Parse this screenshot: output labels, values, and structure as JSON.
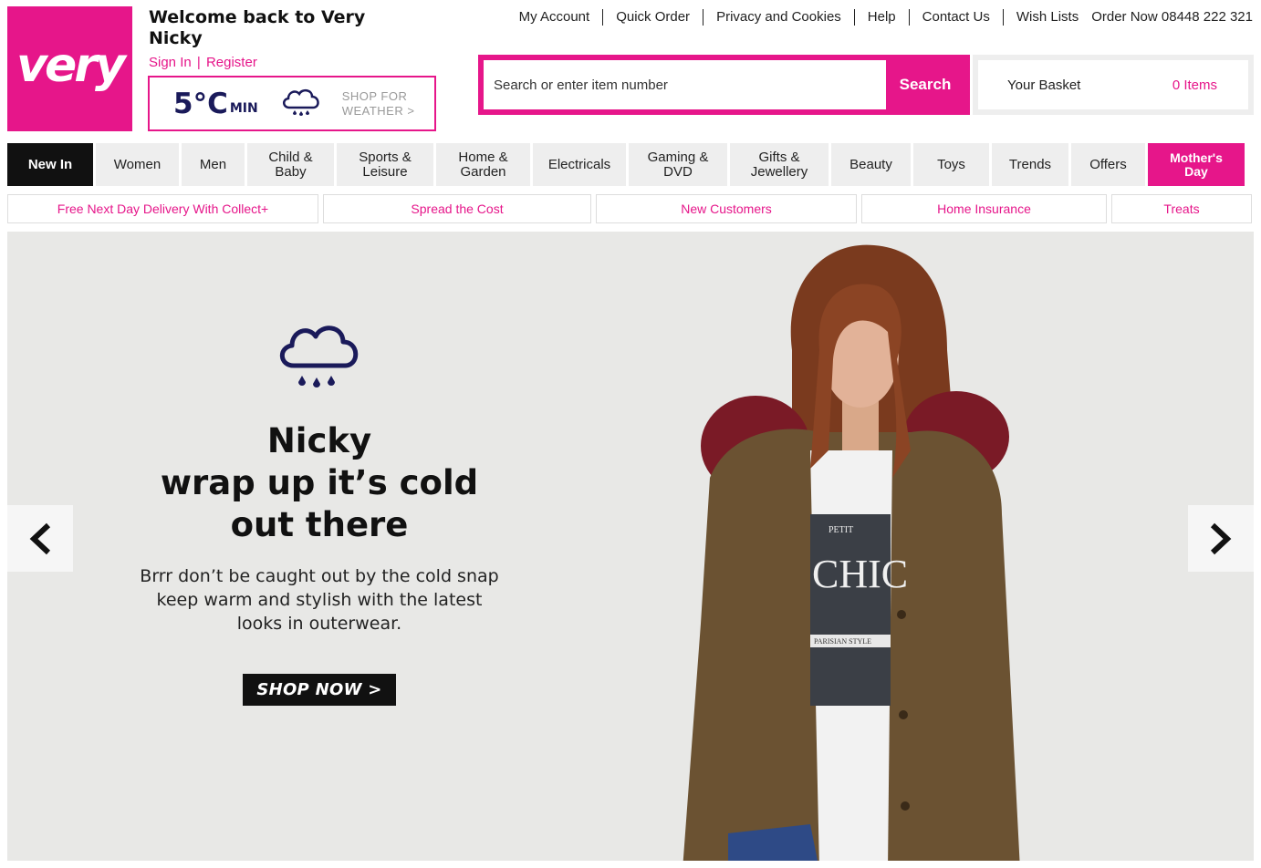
{
  "brand": {
    "logo_text": "very",
    "accent": "#e6168a"
  },
  "welcome": {
    "title_line1": "Welcome back to Very",
    "title_line2": "Nicky",
    "sign_in": "Sign In",
    "separator": "|",
    "register": "Register"
  },
  "weather_widget": {
    "temp": "5°C",
    "temp_label": "MIN",
    "icon": "rain-cloud-icon",
    "link_line1": "SHOP FOR",
    "link_line2": "WEATHER >"
  },
  "top_links": {
    "items": [
      "My Account",
      "Quick Order",
      "Privacy and Cookies",
      "Help",
      "Contact Us",
      "Wish Lists"
    ],
    "phone": "Order Now 08448 222 321"
  },
  "search": {
    "placeholder": "Search or enter item number",
    "button": "Search"
  },
  "basket": {
    "label": "Your Basket",
    "count": "0 Items"
  },
  "main_nav": [
    {
      "line1": "New In",
      "line2": ""
    },
    {
      "line1": "Women",
      "line2": ""
    },
    {
      "line1": "Men",
      "line2": ""
    },
    {
      "line1": "Child &",
      "line2": "Baby"
    },
    {
      "line1": "Sports &",
      "line2": "Leisure"
    },
    {
      "line1": "Home &",
      "line2": "Garden"
    },
    {
      "line1": "Electricals",
      "line2": ""
    },
    {
      "line1": "Gaming &",
      "line2": "DVD"
    },
    {
      "line1": "Gifts &",
      "line2": "Jewellery"
    },
    {
      "line1": "Beauty",
      "line2": ""
    },
    {
      "line1": "Toys",
      "line2": ""
    },
    {
      "line1": "Trends",
      "line2": ""
    },
    {
      "line1": "Offers",
      "line2": ""
    },
    {
      "line1": "Mother's",
      "line2": "Day"
    }
  ],
  "promos": [
    "Free Next Day Delivery With Collect+",
    "Spread the Cost",
    "New Customers",
    "Home Insurance",
    "Treats"
  ],
  "hero": {
    "icon": "rain-cloud-icon",
    "title_line1": "Nicky",
    "title_line2": "wrap up it’s cold",
    "title_line3": "out there",
    "text_line1": "Brrr don’t be caught out by the cold snap",
    "text_line2": "keep warm and stylish with the latest",
    "text_line3": "looks in outerwear.",
    "cta": "SHOP NOW >",
    "tshirt_line1": "PETIT",
    "tshirt_line2": "CHIC",
    "tshirt_line3": "PARISIAN STYLE",
    "prev_icon": "chevron-left-icon",
    "next_icon": "chevron-right-icon"
  }
}
